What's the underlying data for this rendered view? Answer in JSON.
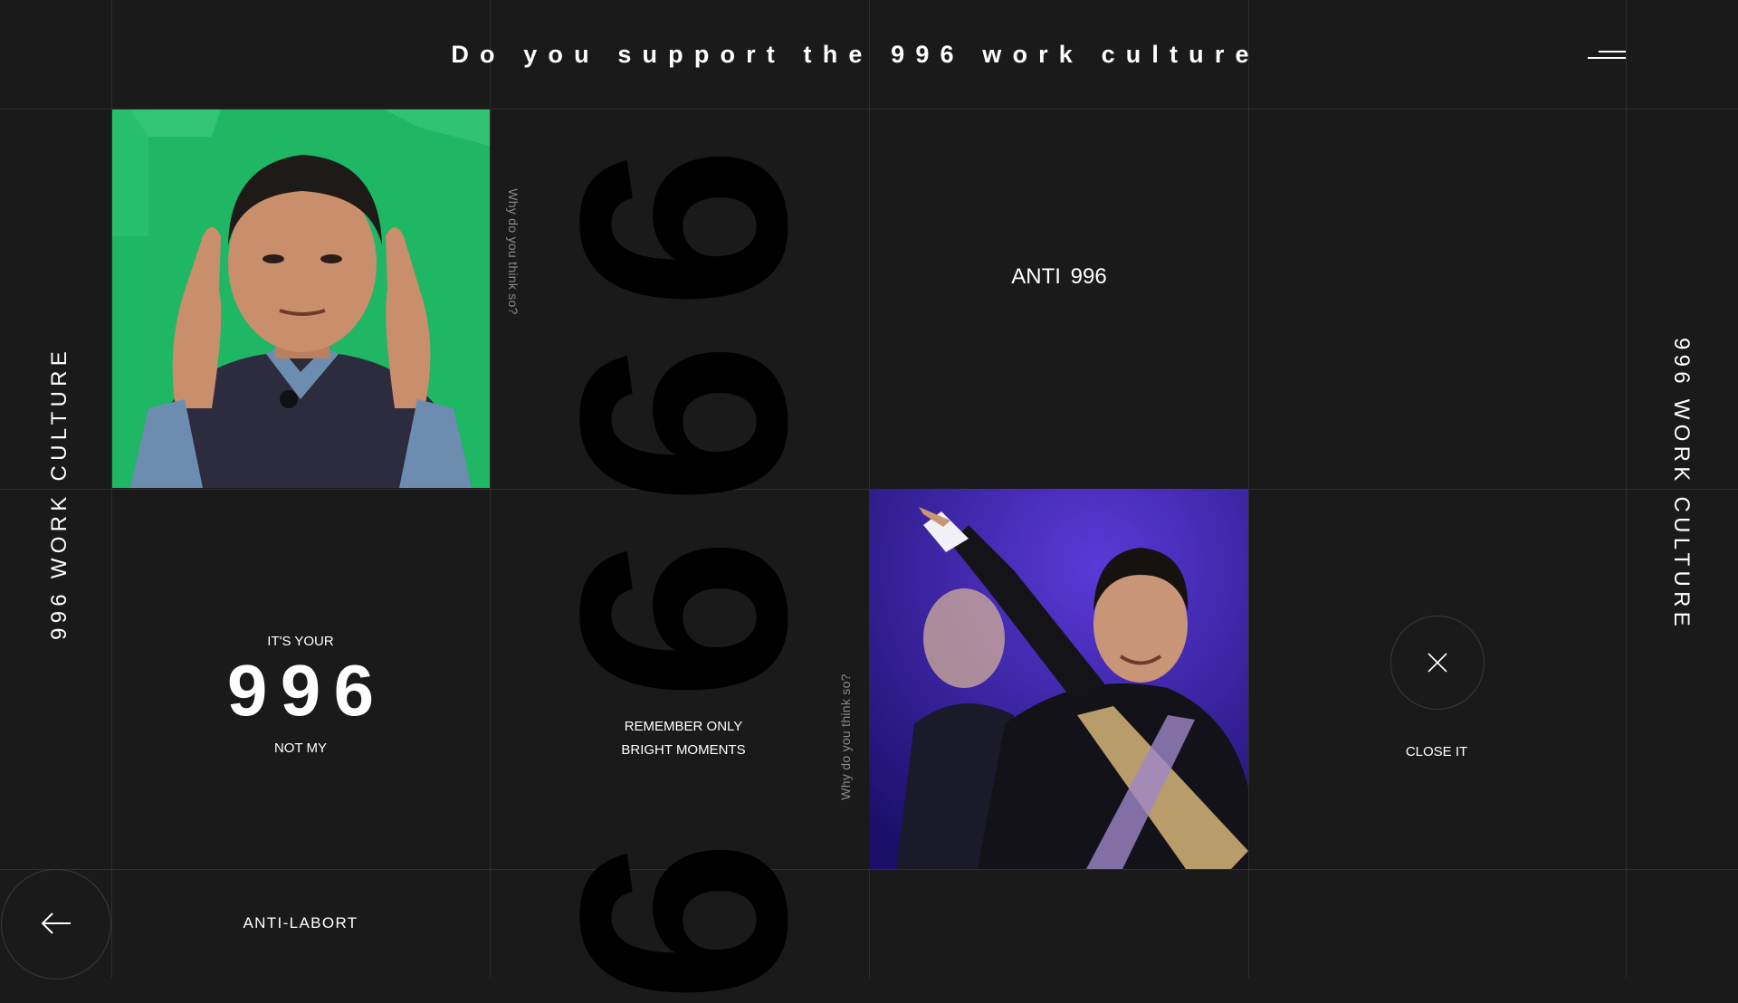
{
  "header": {
    "title": "Do you support the 996 work culture",
    "menu_icon": "menu-icon"
  },
  "side_labels": {
    "left": "996 WORK CULTURE",
    "right": "996 WORK CULTURE"
  },
  "background_digits": [
    "9",
    "9",
    "9",
    "9"
  ],
  "vertical_questions": [
    "Why do you think so?",
    "Why do you think so?"
  ],
  "anti_label": "ANTI  996",
  "center_block": {
    "kicker": "IT'S YOUR",
    "number": "996",
    "footer": "NOT MY"
  },
  "remember": {
    "line1": "REMEMBER ONLY",
    "line2": "BRIGHT MOMENTS"
  },
  "close": {
    "icon": "close-icon",
    "label": "CLOSE IT"
  },
  "footer": {
    "back_icon": "arrow-left-icon",
    "link_label": "ANTI-LABORT"
  },
  "colors": {
    "background": "#1a1a1b",
    "grid_line": "#2e2e30",
    "text": "#ffffff",
    "muted_text": "#8a8a8c",
    "giant_digits": "#000000"
  }
}
